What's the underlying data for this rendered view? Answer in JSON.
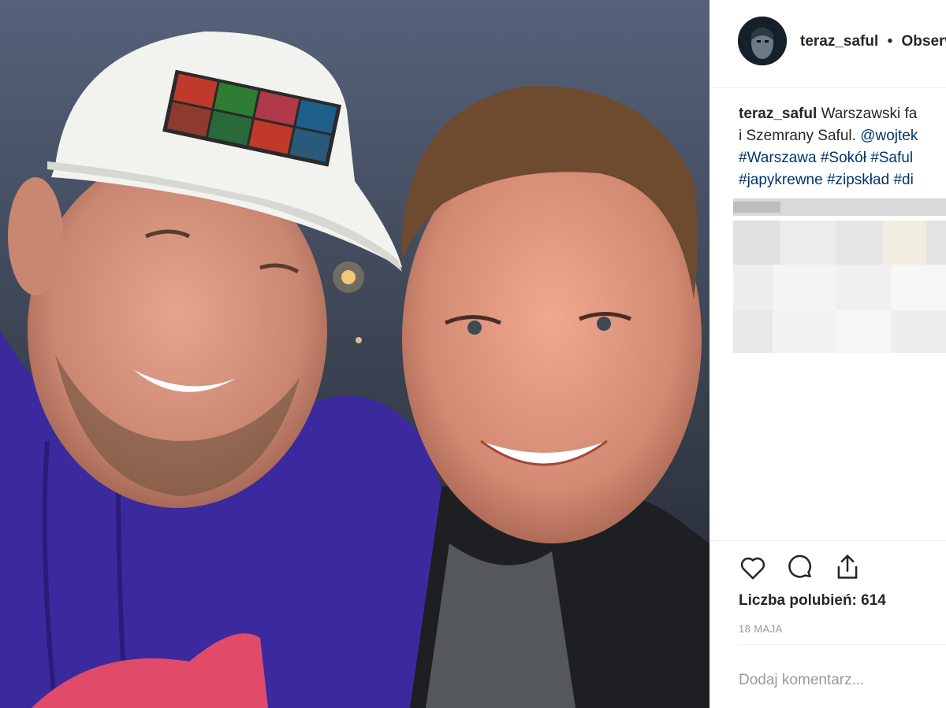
{
  "post": {
    "username": "teraz_saful",
    "separator": "•",
    "follow_label": "Obserwuj"
  },
  "caption": {
    "username": "teraz_saful",
    "line1_text": "Warszawski fa",
    "line2_text": "i Szemrany Saful.",
    "line2_mention": "@wojtek",
    "line3_tags": "#Warszawa #Sokół #Saful",
    "line4_tags": "#japykrewne #zipskład #di"
  },
  "actions": {
    "like_icon": "heart-icon",
    "comment_icon": "comment-bubble-icon",
    "share_icon": "share-upload-icon"
  },
  "likes_text": "Liczba polubień: 614",
  "date_text": "18 MAJA",
  "comment": {
    "placeholder": "Dodaj komentarz..."
  },
  "colors": {
    "link": "#003569",
    "meta": "#999999",
    "text": "#262626",
    "hoodie": "#3b2a9e"
  }
}
